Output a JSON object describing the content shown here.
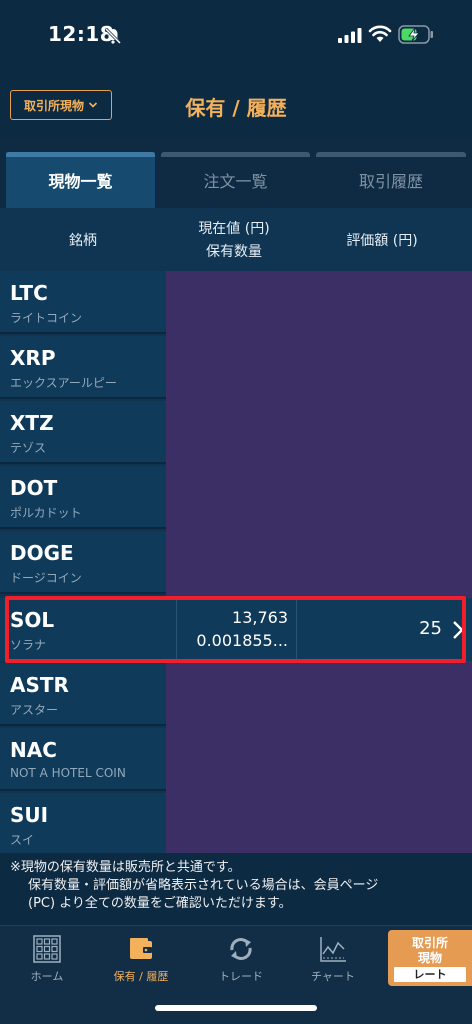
{
  "status": {
    "time": "12:18"
  },
  "header": {
    "exchange_button": "取引所現物",
    "title": "保有 / 履歴"
  },
  "tabs": [
    {
      "label": "現物一覧",
      "active": true
    },
    {
      "label": "注文一覧",
      "active": false
    },
    {
      "label": "取引履歴",
      "active": false
    }
  ],
  "columns": {
    "name": "銘柄",
    "price_line1": "現在値 (円)",
    "price_line2": "保有数量",
    "valuation": "評価額 (円)"
  },
  "coins": [
    {
      "symbol": "LTC",
      "name": "ライトコイン"
    },
    {
      "symbol": "XRP",
      "name": "エックスアールピー"
    },
    {
      "symbol": "XTZ",
      "name": "テゾス"
    },
    {
      "symbol": "DOT",
      "name": "ポルカドット"
    },
    {
      "symbol": "DOGE",
      "name": "ドージコイン"
    },
    {
      "symbol": "SOL",
      "name": "ソラナ",
      "price": "13,763",
      "quantity": "0.001855...",
      "valuation": "25"
    },
    {
      "symbol": "ASTR",
      "name": "アスター"
    },
    {
      "symbol": "NAC",
      "name": "NOT A HOTEL COIN"
    },
    {
      "symbol": "SUI",
      "name": "スイ"
    }
  ],
  "note": {
    "line1": "※現物の保有数量は販売所と共通です。",
    "line2": "保有数量・評価額が省略表示されている場合は、会員ページ",
    "line3": "(PC) より全ての数量をご確認いただけます。"
  },
  "tabbar": {
    "home": "ホーム",
    "holdings": "保有 / 履歴",
    "trade": "トレード",
    "chart": "チャート",
    "rate_line1": "取引所",
    "rate_line2": "現物",
    "rate_line3": "レート"
  },
  "colors": {
    "accent": "#f3b15c",
    "highlight": "#ef1f2c",
    "purple": "#3b2f66"
  }
}
